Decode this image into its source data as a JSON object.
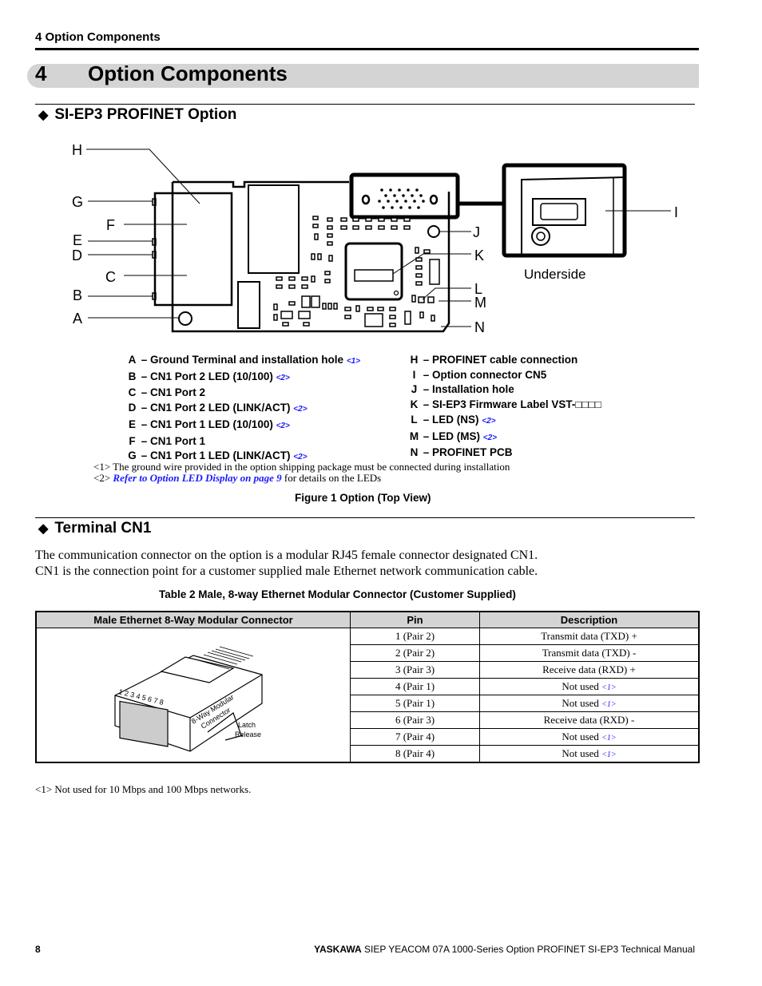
{
  "running_header": "4  Option Components",
  "chapter": {
    "number": "4",
    "title": "Option Components"
  },
  "section1": {
    "title": "SI-EP3 PROFINET Option",
    "diagram": {
      "callouts": [
        "A",
        "B",
        "C",
        "D",
        "E",
        "F",
        "G",
        "H",
        "I",
        "J",
        "K",
        "L",
        "M",
        "N"
      ],
      "underside_label": "Underside"
    },
    "legend_left": [
      {
        "key": "A",
        "text": "– Ground Terminal and installation hole",
        "ref": "<1>"
      },
      {
        "key": "B",
        "text": "– CN1 Port 2 LED (10/100)",
        "ref": "<2>"
      },
      {
        "key": "C",
        "text": "– CN1 Port 2",
        "ref": ""
      },
      {
        "key": "D",
        "text": "– CN1 Port 2 LED (LINK/ACT)",
        "ref": "<2>"
      },
      {
        "key": "E",
        "text": "– CN1 Port 1 LED (10/100)",
        "ref": "<2>"
      },
      {
        "key": "F",
        "text": "– CN1 Port 1",
        "ref": ""
      },
      {
        "key": "G",
        "text": "– CN1 Port 1 LED (LINK/ACT)",
        "ref": "<2>"
      }
    ],
    "legend_right": [
      {
        "key": "H",
        "text": "– PROFINET cable connection",
        "ref": ""
      },
      {
        "key": "I",
        "text": "– Option connector CN5",
        "ref": ""
      },
      {
        "key": "J",
        "text": "– Installation hole",
        "ref": ""
      },
      {
        "key": "K",
        "text": "– SI-EP3 Firmware Label VST-□□□□",
        "ref": ""
      },
      {
        "key": "L",
        "text": "– LED (NS)",
        "ref": "<2>"
      },
      {
        "key": "M",
        "text": "– LED (MS)",
        "ref": "<2>"
      },
      {
        "key": "N",
        "text": "– PROFINET PCB",
        "ref": ""
      }
    ],
    "footnotes": {
      "note1": "<1> The ground wire provided in the option shipping package must be connected during installation",
      "note2_prefix": "<2> ",
      "note2_link": "Refer to Option LED Display on page 9",
      "note2_suffix": " for details on the LEDs"
    },
    "figure_caption": "Figure 1  Option (Top View)"
  },
  "section2": {
    "title": "Terminal CN1",
    "paragraph_line1": "The communication connector on the option is a modular RJ45 female connector designated CN1.",
    "paragraph_line2": "CN1 is the connection point for a customer supplied male Ethernet network communication cable.",
    "table_caption": "Table 2  Male, 8-way Ethernet Modular Connector (Customer Supplied)",
    "table": {
      "headers": [
        "Male Ethernet 8-Way Modular Connector",
        "Pin",
        "Description"
      ],
      "image_labels": {
        "pins": "1 2 3 4 5 6 7 8",
        "connector": "8-Way Modular",
        "connector2": "Connector",
        "latch": "Latch",
        "release": "Release"
      },
      "rows": [
        {
          "pin": "1 (Pair 2)",
          "desc": "Transmit data (TXD) +",
          "ref": ""
        },
        {
          "pin": "2 (Pair 2)",
          "desc": "Transmit data (TXD) -",
          "ref": ""
        },
        {
          "pin": "3 (Pair 3)",
          "desc": "Receive data (RXD) +",
          "ref": ""
        },
        {
          "pin": "4 (Pair 1)",
          "desc": "Not used ",
          "ref": "<1>"
        },
        {
          "pin": "5 (Pair 1)",
          "desc": "Not used",
          "ref": "<1>"
        },
        {
          "pin": "6 (Pair 3)",
          "desc": "Receive data (RXD) -",
          "ref": ""
        },
        {
          "pin": "7 (Pair 4)",
          "desc": "Not used",
          "ref": "<1>"
        },
        {
          "pin": "8 (Pair 4)",
          "desc": "Not used",
          "ref": "<1>"
        }
      ]
    },
    "table_footnote": "<1> Not used for 10 Mbps and 100 Mbps networks."
  },
  "footer": {
    "page_number": "8",
    "brand": "YASKAWA",
    "doc_title": " SIEP YEACOM 07A 1000-Series Option PROFINET SI-EP3 Technical Manual"
  },
  "colors": {
    "link": "#1a1aff",
    "header_gray": "#d4d4d4"
  }
}
